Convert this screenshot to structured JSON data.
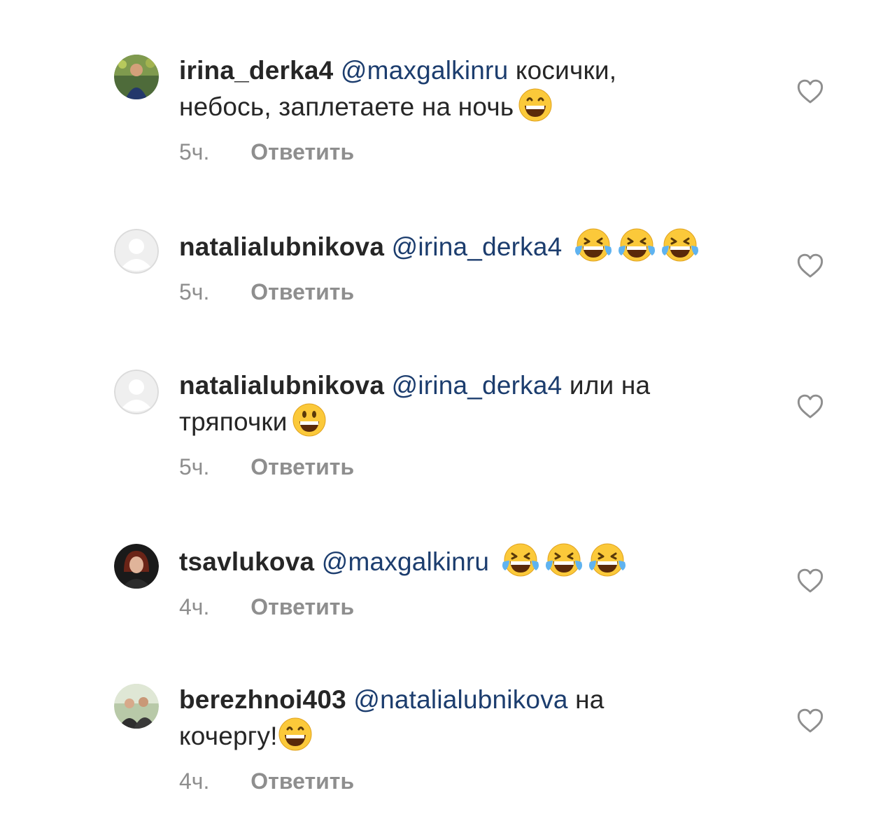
{
  "comments": [
    {
      "username": "irina_derka4",
      "mention": "@maxgalkinru",
      "text_line1": "косички,",
      "text_line2": "небось, заплетаете на ночь",
      "emoji": "grinning-smile",
      "time": "5ч.",
      "reply_label": "Ответить",
      "avatar": "photo-avatar"
    },
    {
      "username": "natalialubnikova",
      "mention": "@irina_derka4",
      "text_line1": "",
      "text_line2": "",
      "emoji": "tears-of-joy x3",
      "time": "5ч.",
      "reply_label": "Ответить",
      "avatar": "default-avatar"
    },
    {
      "username": "natalialubnikova",
      "mention": "@irina_derka4",
      "text_line1": "или на",
      "text_line2": "тряпочки",
      "emoji": "grinning-face",
      "time": "5ч.",
      "reply_label": "Ответить",
      "avatar": "default-avatar"
    },
    {
      "username": "tsavlukova",
      "mention": "@maxgalkinru",
      "text_line1": "",
      "text_line2": "",
      "emoji": "tears-of-joy x3",
      "time": "4ч.",
      "reply_label": "Ответить",
      "avatar": "photo-avatar"
    },
    {
      "username": "berezhnoi403",
      "mention": "@natalialubnikova",
      "text_line1": "на",
      "text_line2": "кочергу!",
      "emoji": "grinning-smile",
      "time": "4ч.",
      "reply_label": "Ответить",
      "avatar": "photo-avatar"
    }
  ],
  "colors": {
    "text": "#262626",
    "mention": "#1c3d6e",
    "secondary": "#8e8e8e"
  },
  "icons": {
    "like": "heart-outline-icon"
  }
}
